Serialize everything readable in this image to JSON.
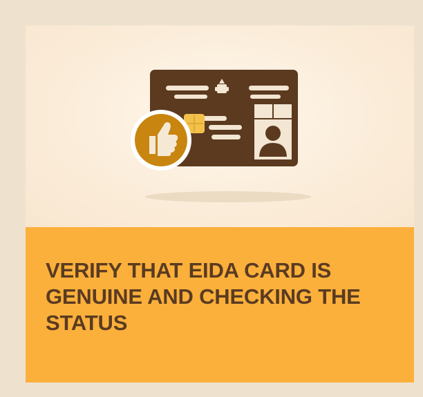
{
  "tile": {
    "title": "VERIFY THAT EIDA CARD IS GENUINE AND CHECKING THE STATUS",
    "icon": "id-card-verify-icon",
    "badge_icon": "thumbs-up-icon"
  },
  "colors": {
    "page_background": "#eee2cf",
    "tile_top_background": "#fbecd9",
    "tile_bottom_background": "#fbb03b",
    "title_text": "#5a3b22",
    "card_body": "#5b3a1f",
    "badge": "#c8850f"
  }
}
